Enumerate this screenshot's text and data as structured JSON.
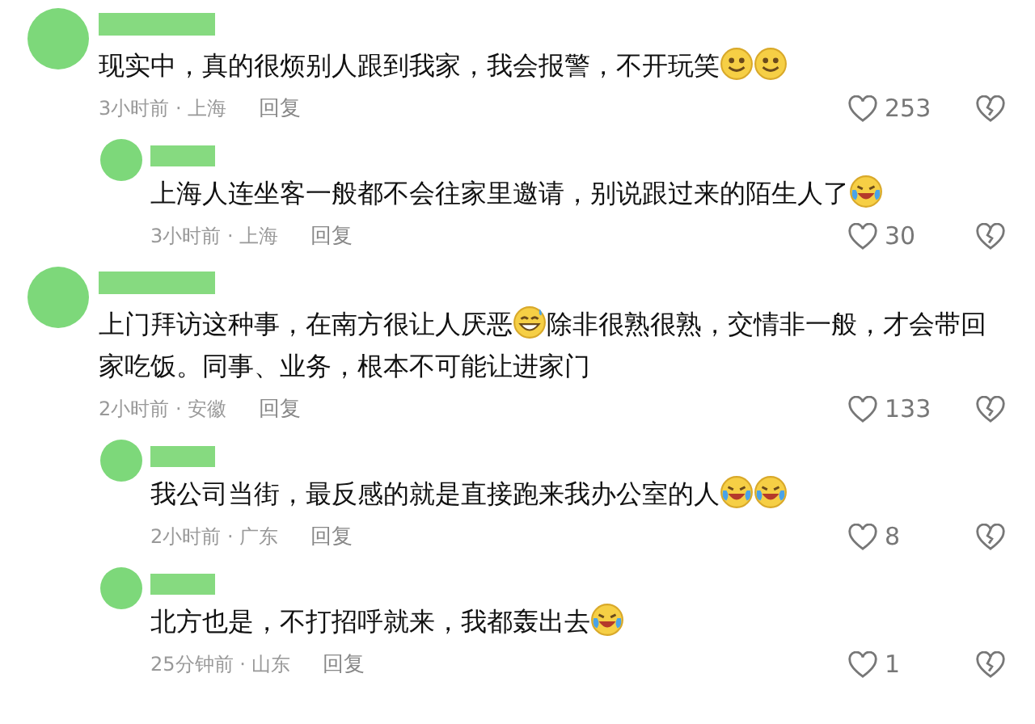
{
  "comments": [
    {
      "segments": [
        {
          "kind": "text",
          "text": "现实中，真的很烦别人跟到我家，我会报警，不开玩笑"
        },
        {
          "kind": "smile"
        },
        {
          "kind": "smile"
        }
      ],
      "time": "3小时前 · 上海",
      "reply": "回复",
      "likes": "253",
      "replies": [
        {
          "segments": [
            {
              "kind": "text",
              "text": "上海人连坐客一般都不会往家里邀请，别说跟过来的陌生人了"
            },
            {
              "kind": "laugh-cry"
            }
          ],
          "time": "3小时前 · 上海",
          "reply": "回复",
          "likes": "30"
        }
      ]
    },
    {
      "segments": [
        {
          "kind": "text",
          "text": "上门拜访这种事，在南方很让人厌恶"
        },
        {
          "kind": "grin-sweat"
        },
        {
          "kind": "text",
          "text": "除非很熟很熟，交情非一般，才会带回家吃饭。同事、业务，根本不可能让进家门"
        }
      ],
      "time": "2小时前 · 安徽",
      "reply": "回复",
      "likes": "133",
      "replies": [
        {
          "segments": [
            {
              "kind": "text",
              "text": "我公司当街，最反感的就是直接跑来我办公室的人"
            },
            {
              "kind": "laugh-cry"
            },
            {
              "kind": "laugh-cry"
            }
          ],
          "time": "2小时前 · 广东",
          "reply": "回复",
          "likes": "8"
        },
        {
          "segments": [
            {
              "kind": "text",
              "text": "北方也是，不打招呼就来，我都轰出去"
            },
            {
              "kind": "laugh-cry"
            }
          ],
          "time": "25分钟前 · 山东",
          "reply": "回复",
          "likes": "1"
        }
      ]
    }
  ]
}
